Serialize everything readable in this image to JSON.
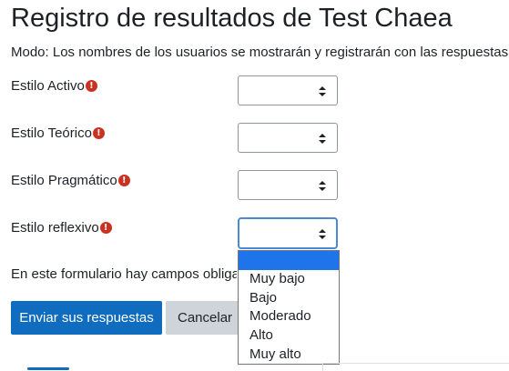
{
  "page": {
    "title": "Registro de resultados de Test Chaea",
    "mode": "Modo: Los nombres de los usuarios se mostrarán y registrarán con las respuestas"
  },
  "fields": [
    {
      "label": "Estilo Activo",
      "value": ""
    },
    {
      "label": "Estilo Teórico",
      "value": ""
    },
    {
      "label": "Estilo Pragmático",
      "value": ""
    },
    {
      "label": "Estilo reflexivo",
      "value": ""
    }
  ],
  "required_icon": "exclamation-circle-icon",
  "required_glyph": "!",
  "dropdown": {
    "open_for": "Estilo reflexivo",
    "options": [
      "",
      "Muy bajo",
      "Bajo",
      "Moderado",
      "Alto",
      "Muy alto"
    ],
    "selected_index": 0
  },
  "notice": "En este formulario hay campos obligatorios",
  "buttons": {
    "submit": "Enviar sus respuestas",
    "cancel": "Cancelar"
  },
  "colors": {
    "primary": "#0f6cbf",
    "required": "#ca3120",
    "focus": "#4a88d3",
    "option_highlight": "#1e74e8"
  }
}
